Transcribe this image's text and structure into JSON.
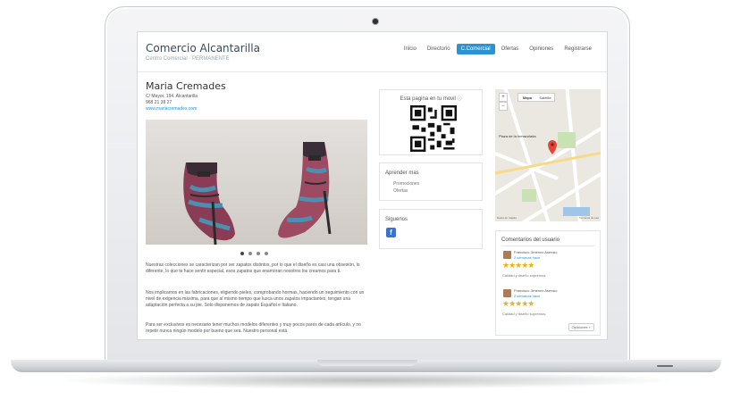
{
  "site": {
    "title": "Comercio Alcantarilla",
    "subtitle": "Centro Comercial · PERMANENTE"
  },
  "nav": [
    "Inicio",
    "Directorio",
    "C.Comercial",
    "Ofertas",
    "Opiniones",
    "Registrarse"
  ],
  "nav_active": "C.Comercial",
  "business": {
    "name": "Maria Cremades",
    "address": "C/ Mayor, 194. Alcantarilla",
    "phone": "968 21 38 27",
    "website": "www.mariacremades.com"
  },
  "carousel": {
    "slides": 4,
    "current": 1
  },
  "description": [
    "Nuestras colecciones se caracterizan por ser zapatos distintos, por lo que el diseño es casi una obsesión, lo diferente, lo que te hace sentir especial, esos zapatos que enamoran nosotros los creamos para ti.",
    "Nos implicamos en las fabricaciones, eligiendo pieles, comprobando hormas, haciendo un seguimiento con un nivel de exigencia máxima, para que al mismo tiempo que luzca unos zapatos impactantes, tengan una adaptación perfecta a su pie. Solo disponemos de zapato Español e Italiano.",
    "Para ser exclusivos es necesario tener muchos modelos diferentes y muy pocos pares de cada artículo, y no repetir nunca ningún modelo por bueno que sea. Nuestro personal está"
  ],
  "qr_box": {
    "title": "Esta pagina en tu movil"
  },
  "learn_box": {
    "title": "Aprender mas",
    "links": [
      "Promociones",
      "Ofertas"
    ]
  },
  "follow_box": {
    "title": "Siguenos",
    "network": "f"
  },
  "map": {
    "zoom_in": "+",
    "zoom_out": "−",
    "type_options": [
      "Mapa",
      "Satélite"
    ],
    "place_label": "Plaza de la Inmaculada",
    "attribution": "Datos de mapas",
    "terms": "Términos de uso"
  },
  "comments": {
    "title": "Comentarios del usuario",
    "items": [
      {
        "name": "Francisco Jiménez Asensio",
        "time": "2 semanas hace",
        "rating": 5,
        "text": "Calidad y diseño supremos."
      },
      {
        "name": "Francisco Jiménez Asensio",
        "time": "2 semanas hace",
        "rating": 5,
        "text": "Calidad y diseño supremos."
      }
    ],
    "more_label": "Opiniones +"
  },
  "colors": {
    "accent": "#2a93d5",
    "star": "#e9b21b",
    "facebook": "#3b73c8",
    "title_text": "#34495e"
  },
  "icons": [
    "camera-icon",
    "qr-code-icon",
    "info-icon",
    "facebook-icon",
    "map-pin-icon",
    "star-icon"
  ]
}
